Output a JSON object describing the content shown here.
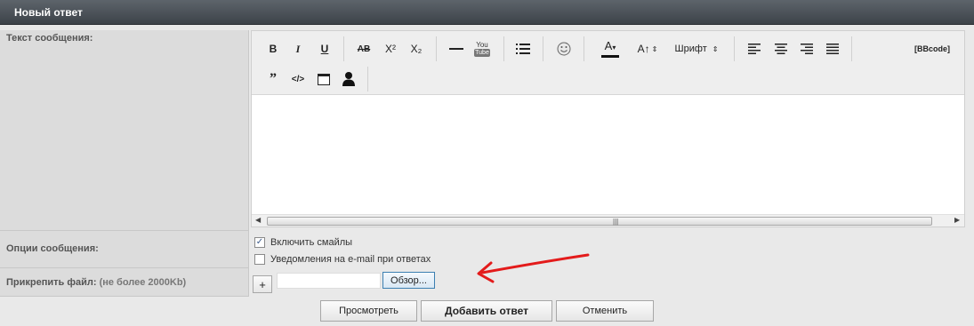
{
  "header": {
    "title": "Новый ответ"
  },
  "labels": {
    "message_text": "Текст сообщения:",
    "message_options": "Опции сообщения:",
    "attach_file": "Прикрепить файл:",
    "attach_limit": "(не более 2000Kb)"
  },
  "toolbar": {
    "bold": "B",
    "italic": "I",
    "underline": "U",
    "strike": "AB",
    "superscript": "X²",
    "subscript": "X₂",
    "youtube": "You Tube",
    "font_size": "A↑",
    "font_family": "Шрифт",
    "bbcode": "[BBcode]",
    "quote": "”",
    "code": "</>"
  },
  "options": {
    "enable_smilies": "Включить смайлы",
    "enable_smilies_checked": true,
    "email_notify": "Уведомления на e-mail при ответах",
    "email_notify_checked": false
  },
  "attach": {
    "add_label": "+",
    "browse_label": "Обзор..."
  },
  "buttons": {
    "preview": "Просмотреть",
    "submit": "Добавить ответ",
    "cancel": "Отменить"
  },
  "colors": {
    "header": "#4a5057",
    "arrow": "#e31b1b"
  }
}
